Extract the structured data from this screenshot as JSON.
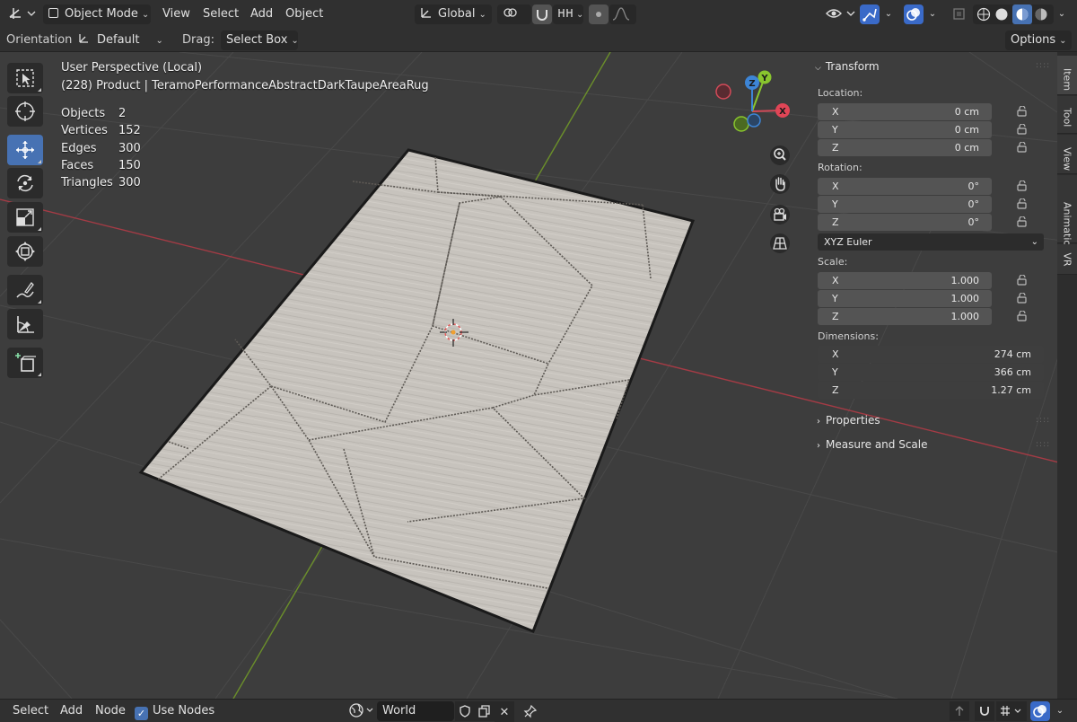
{
  "header": {
    "mode": "Object Mode",
    "menu": [
      "View",
      "Select",
      "Add",
      "Object"
    ],
    "transform_orientation": "Global"
  },
  "toolsettings": {
    "orientation_label": "Orientation:",
    "orientation_value": "Default",
    "drag_label": "Drag:",
    "drag_value": "Select Box",
    "options_label": "Options"
  },
  "viewport": {
    "view_name": "User Perspective (Local)",
    "object_info": "(228) Product | TeramoPerformanceAbstractDarkTaupeAreaRug",
    "stats": [
      {
        "label": "Objects",
        "value": "2"
      },
      {
        "label": "Vertices",
        "value": "152"
      },
      {
        "label": "Edges",
        "value": "300"
      },
      {
        "label": "Faces",
        "value": "150"
      },
      {
        "label": "Triangles",
        "value": "300"
      }
    ],
    "gizmo_axes": [
      "X",
      "Y",
      "Z"
    ]
  },
  "npanel": {
    "transform_title": "Transform",
    "location_label": "Location:",
    "location": [
      {
        "axis": "X",
        "value": "0 cm"
      },
      {
        "axis": "Y",
        "value": "0 cm"
      },
      {
        "axis": "Z",
        "value": "0 cm"
      }
    ],
    "rotation_label": "Rotation:",
    "rotation": [
      {
        "axis": "X",
        "value": "0°"
      },
      {
        "axis": "Y",
        "value": "0°"
      },
      {
        "axis": "Z",
        "value": "0°"
      }
    ],
    "rotation_mode": "XYZ Euler",
    "scale_label": "Scale:",
    "scale": [
      {
        "axis": "X",
        "value": "1.000"
      },
      {
        "axis": "Y",
        "value": "1.000"
      },
      {
        "axis": "Z",
        "value": "1.000"
      }
    ],
    "dimensions_label": "Dimensions:",
    "dimensions": [
      {
        "axis": "X",
        "value": "274 cm"
      },
      {
        "axis": "Y",
        "value": "366 cm"
      },
      {
        "axis": "Z",
        "value": "1.27 cm"
      }
    ],
    "properties_title": "Properties",
    "measure_title": "Measure and Scale"
  },
  "tabs": [
    "Item",
    "Tool",
    "View",
    "Animation",
    "VR"
  ],
  "footer": {
    "menu": [
      "Select",
      "Add",
      "Node"
    ],
    "use_nodes_label": "Use Nodes",
    "world_name": "World"
  },
  "colors": {
    "accent": "#4772b3",
    "axis_x": "#e04556",
    "axis_y": "#88c52a",
    "axis_z": "#3d85d6"
  }
}
